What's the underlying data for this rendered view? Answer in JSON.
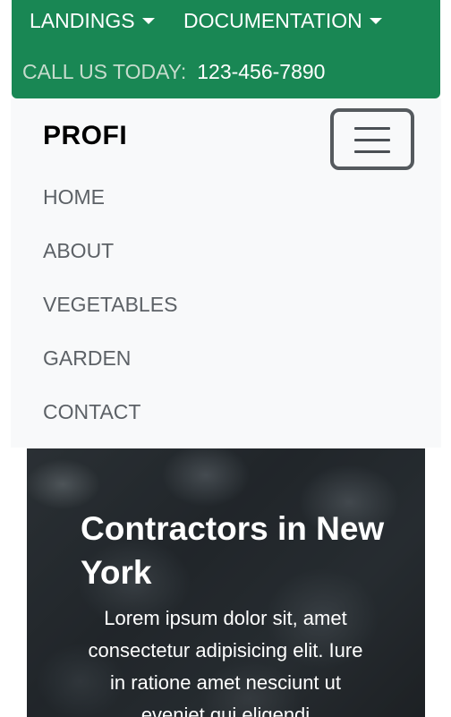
{
  "topbar": {
    "landings_label": "LANDINGS",
    "documentation_label": "DOCUMENTATION",
    "call_label": "CALL US TODAY:",
    "phone": "123-456-7890",
    "bg_color": "#198754"
  },
  "navbar": {
    "brand": "PROFI",
    "toggler_icon": "hamburger-menu-icon",
    "links": [
      "HOME",
      "ABOUT",
      "VEGETABLES",
      "GARDEN",
      "CONTACT"
    ],
    "bg_color": "#f8f9fa"
  },
  "hero": {
    "title": "Contractors in New York",
    "text": "Lorem ipsum dolor sit, amet consectetur adipisicing elit. Iure in ratione amet nesciunt ut eveniet qui eligendi"
  }
}
